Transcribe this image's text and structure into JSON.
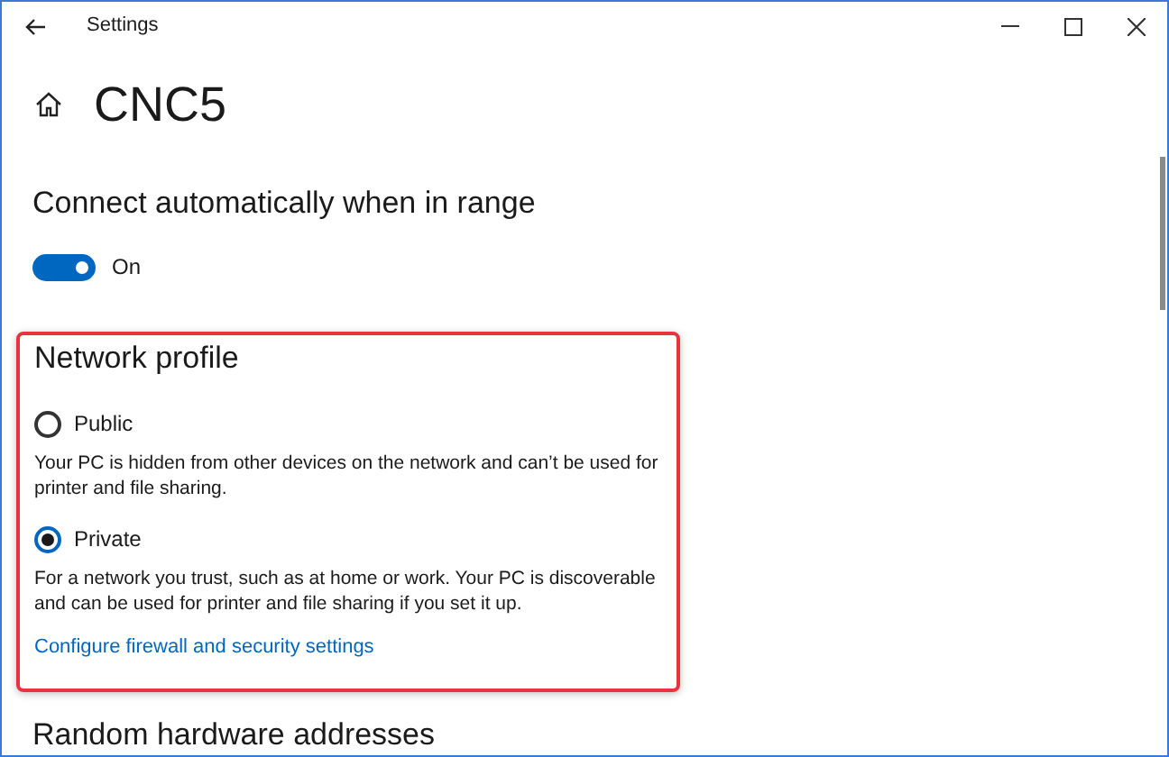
{
  "window": {
    "title": "Settings"
  },
  "page": {
    "title": "CNC5"
  },
  "auto_connect": {
    "heading": "Connect automatically when in range",
    "on": true,
    "label": "On"
  },
  "network_profile": {
    "heading": "Network profile",
    "highlighted": true,
    "options": [
      {
        "label": "Public",
        "selected": false,
        "description": "Your PC is hidden from other devices on the network and can’t be used for printer and file sharing."
      },
      {
        "label": "Private",
        "selected": true,
        "description": "For a network you trust, such as at home or work. Your PC is discoverable and can be used for printer and file sharing if you set it up."
      }
    ],
    "link": "Configure firewall and security settings"
  },
  "next_section": {
    "heading": "Random hardware addresses"
  }
}
